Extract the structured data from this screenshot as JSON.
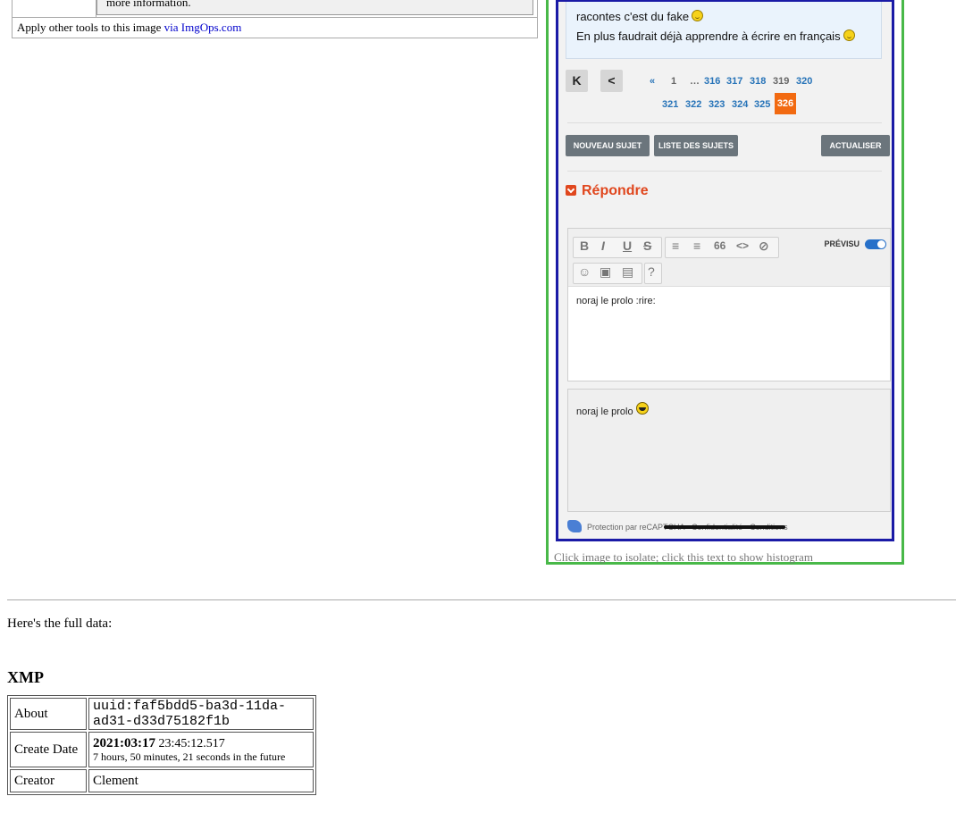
{
  "top_table": {
    "note_text": "more information.",
    "apply_prefix": "Apply other tools to this image ",
    "apply_link": "via ImgOps.com"
  },
  "screenshot": {
    "message_lines": [
      "racontes c'est du fake",
      "En plus faudrait déjà apprendre à écrire en français"
    ],
    "pagination": {
      "first_icon": "K",
      "prev_icon": "<",
      "row1": [
        "«",
        "1",
        "…",
        "316",
        "317",
        "318",
        "319",
        "320"
      ],
      "row2": [
        "321",
        "322",
        "323",
        "324",
        "325"
      ],
      "current": "326"
    },
    "buttons": {
      "new_topic": "NOUVEAU SUJET",
      "topic_list": "LISTE DES SUJETS",
      "refresh": "ACTUALISER"
    },
    "reply_title": "Répondre",
    "editor": {
      "tools_row1": [
        "B",
        "I",
        "U",
        "S",
        "≡",
        "≡",
        "66",
        "<>",
        "⊘"
      ],
      "tools_row2": [
        "☺",
        "▣",
        "▤",
        "?"
      ],
      "preview_label": "PRÉVISU",
      "text": "noraj le prolo :rire:"
    },
    "preview_text": "noraj le prolo",
    "captcha_text": "Protection par reCAPTCHA · Confidentialité · Conditions",
    "caption": "Click image to isolate; click this text to show histogram",
    "colors": {
      "accent": "#f26a11",
      "link_blue": "#2673b8",
      "frame_green": "#48b848",
      "frame_blue": "#1a1aa6"
    }
  },
  "intro_text": "Here's the full data:",
  "xmp": {
    "heading": "XMP",
    "rows": [
      {
        "key": "About",
        "value": "uuid:faf5bdd5-ba3d-11da-ad31-d33d75182f1b"
      },
      {
        "key": "Create Date",
        "date_bold": "2021:03:17",
        "time": " 23:45:",
        "seconds": "12.517",
        "relative": "7 hours, 50 minutes, 21 seconds in the future"
      },
      {
        "key": "Creator",
        "value": "Clement"
      }
    ]
  }
}
